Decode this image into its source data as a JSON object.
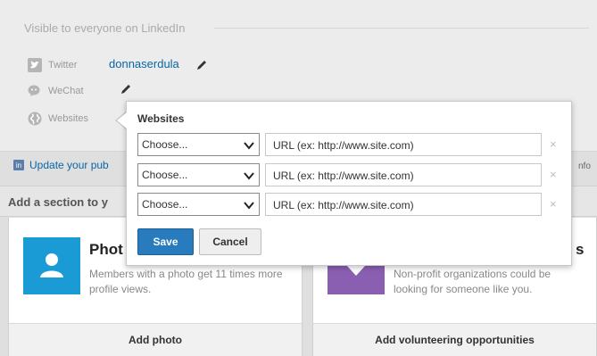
{
  "profile": {
    "visibility_header": "Visible to everyone on LinkedIn",
    "twitter_label": "Twitter",
    "twitter_handle": "donnaserdula",
    "wechat_label": "WeChat",
    "websites_label": "Websites",
    "update_link": "Update your pub",
    "info_text": "nfo"
  },
  "sections": {
    "title": "Add a section to y",
    "photo_card": {
      "heading": "Phot",
      "description": "Members with a photo get 11 times more profile views.",
      "action": "Add photo"
    },
    "volunteer_card": {
      "heading": "s",
      "description": "Non-profit organizations could be looking for someone like you.",
      "action": "Add volunteering opportunities"
    }
  },
  "websites_popup": {
    "title": "Websites",
    "rows": [
      {
        "type": "Choose...",
        "url_placeholder": "URL (ex: http://www.site.com)"
      },
      {
        "type": "Choose...",
        "url_placeholder": "URL (ex: http://www.site.com)"
      },
      {
        "type": "Choose...",
        "url_placeholder": "URL (ex: http://www.site.com)"
      }
    ],
    "remove_symbol": "×",
    "save_label": "Save",
    "cancel_label": "Cancel"
  },
  "colors": {
    "link": "#0a66a8",
    "save_button": "#287bbc",
    "photo_thumb": "#1b9bd6",
    "volunteer_thumb": "#8a5fb1"
  },
  "icons": [
    "twitter-icon",
    "wechat-icon",
    "globe-icon",
    "pencil-icon",
    "linkedin-icon",
    "person-icon",
    "chevron-down-icon",
    "close-icon"
  ]
}
